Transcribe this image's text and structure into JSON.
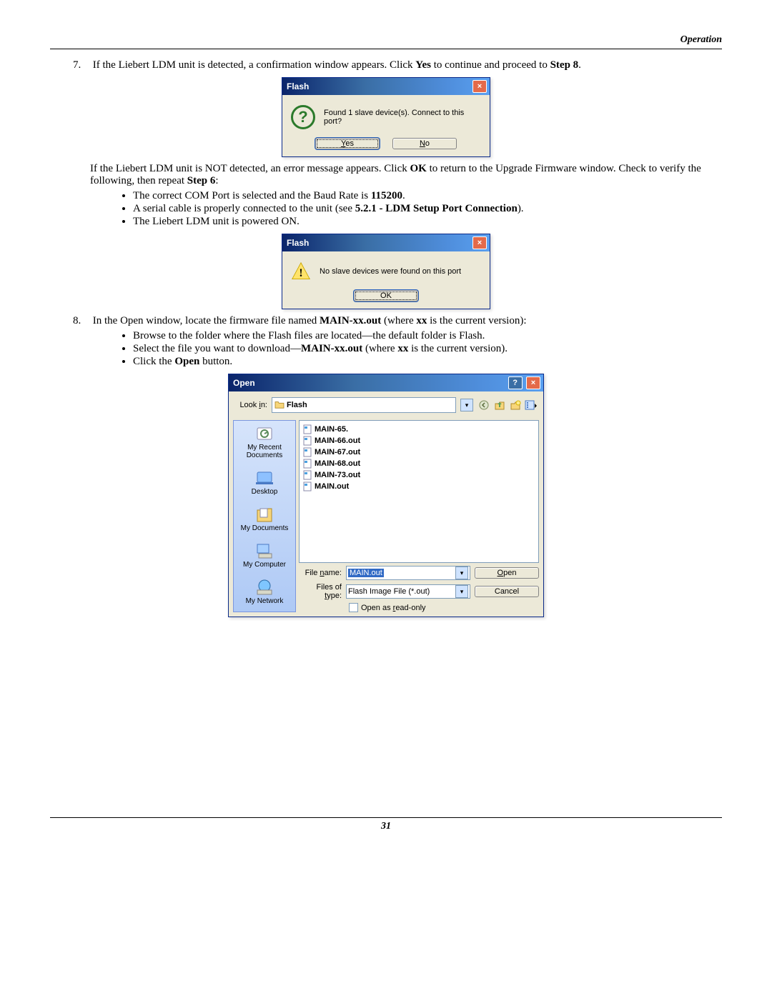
{
  "header": {
    "section": "Operation"
  },
  "step7": {
    "num": "7.",
    "text_a": "If the Liebert LDM unit is detected, a confirmation window appears. Click ",
    "yes": "Yes",
    "text_b": " to continue and proceed to ",
    "step8": "Step 8",
    "text_c": "."
  },
  "dlg_flash1": {
    "title": "Flash",
    "msg": "Found 1 slave device(s).  Connect to this port?",
    "yes": "Yes",
    "no": "No"
  },
  "step7b": {
    "text_a": "If the Liebert LDM unit is NOT detected, an error message appears. Click ",
    "ok": "OK",
    "text_b": " to return to the Upgrade Firmware window. Check to verify the following, then repeat ",
    "step6": "Step 6",
    "text_c": ":",
    "b1a": "The correct COM Port is selected and the Baud Rate is ",
    "b1b": "115200",
    "b1c": ".",
    "b2a": "A serial cable is properly connected to the unit (see ",
    "b2b": "5.2.1 - LDM Setup Port Connection",
    "b2c": ").",
    "b3": "The Liebert LDM unit is powered ON."
  },
  "dlg_flash2": {
    "title": "Flash",
    "msg": "No slave devices were found on this port",
    "ok": "OK"
  },
  "step8": {
    "num": "8.",
    "text_a": "In the Open window, locate the firmware file named ",
    "fname": "MAIN-xx.out",
    "text_b": " (where ",
    "xx": "xx",
    "text_c": " is the current version):",
    "b1": "Browse to the folder where the Flash files are located—the default folder is Flash.",
    "b2a": "Select the file you want to download—",
    "b2b": "MAIN-xx.out",
    "b2c": " (where ",
    "b2d": "xx",
    "b2e": " is the current version).",
    "b3a": "Click the ",
    "b3b": "Open",
    "b3c": " button."
  },
  "dlg_open": {
    "title": "Open",
    "lookin_label": "Look in:",
    "lookin_value": "Flash",
    "places": [
      "My Recent Documents",
      "Desktop",
      "My Documents",
      "My Computer",
      "My Network"
    ],
    "files": [
      "MAIN-65.",
      "MAIN-66.out",
      "MAIN-67.out",
      "MAIN-68.out",
      "MAIN-73.out",
      "MAIN.out"
    ],
    "filename_label": "File name:",
    "filename_value": "MAIN.out",
    "filetype_label": "Files of type:",
    "filetype_value": "Flash Image File (*.out)",
    "readonly_label": "Open as read-only",
    "open_btn": "Open",
    "cancel_btn": "Cancel"
  },
  "page_number": "31"
}
